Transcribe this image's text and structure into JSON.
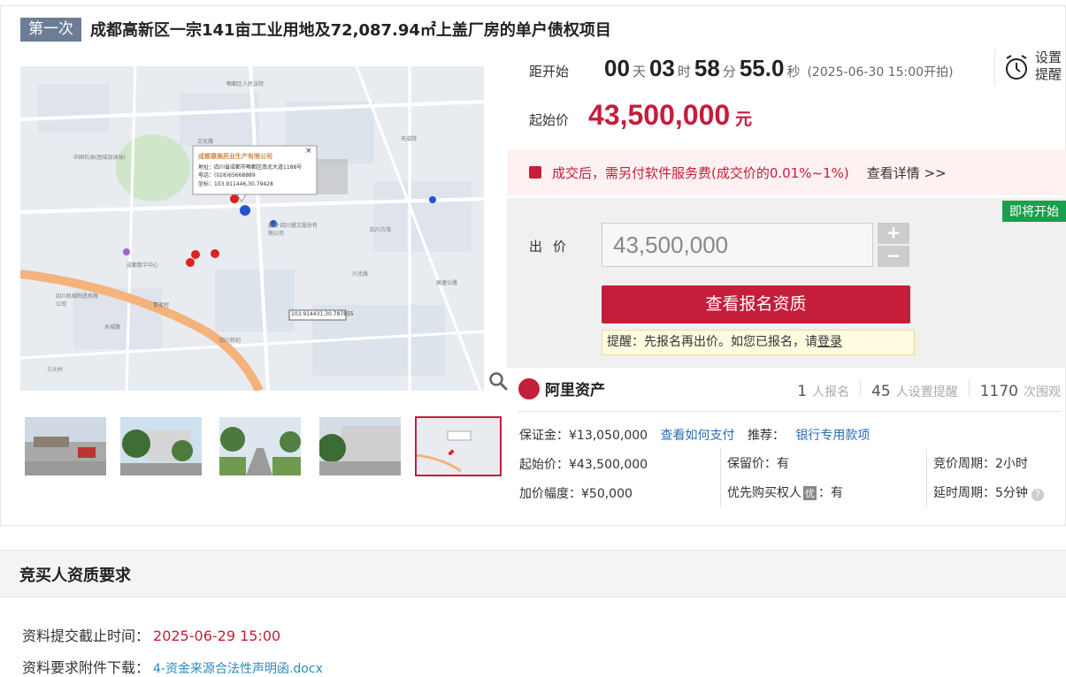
{
  "header": {
    "round_tag": "第一次",
    "title": "成都高新区一宗141亩工业用地及72,087.94㎡上盖厂房的单户债权项目"
  },
  "countdown": {
    "label": "距开始",
    "days": "00",
    "days_unit": "天",
    "hours": "03",
    "hours_unit": "时",
    "minutes": "58",
    "minutes_unit": "分",
    "seconds": "55.0",
    "seconds_unit": "秒",
    "start_text": "(2025-06-30 15:00开拍)"
  },
  "reminder": {
    "line1": "设置",
    "line2": "提醒",
    "icon": "alarm-clock-icon"
  },
  "start_price": {
    "label": "起始价",
    "value": "43,500,000",
    "unit": "元"
  },
  "fee_notice": {
    "text": "成交后，需另付软件服务费(成交价的0.01%~1%)",
    "link": "查看详情 >>"
  },
  "bid": {
    "badge": "即将开始",
    "label": "出价",
    "input_value": "43,500,000",
    "plus": "+",
    "minus": "−",
    "main_button": "查看报名资质",
    "notice_text": "提醒：先报名再出价。如您已报名，请",
    "notice_link": "登录"
  },
  "platform": {
    "name": "阿里资产"
  },
  "stats": [
    {
      "num": "1",
      "unit": "人报名"
    },
    {
      "num": "45",
      "unit": "人设置提醒"
    },
    {
      "num": "1170",
      "unit": "次围观"
    }
  ],
  "details": {
    "deposit": "保证金：¥13,050,000",
    "pay_link": "查看如何支付",
    "recommend_label": "推荐：",
    "recommend_link": "银行专用款项",
    "start_price": "起始价：¥43,500,000",
    "reserve": "保留价：有",
    "cycle": "竞价周期：2小时",
    "increment": "加价幅度：¥50,000",
    "priority_label": "优先购买权人",
    "priority_icon": "优",
    "priority_value": "：有",
    "delay": "延时周期：5分钟"
  },
  "map": {
    "company": "成都康美药业生产有限公司",
    "address": "地址：四川省成都市郫都区南北大道1188号",
    "phone": "电话：(028)65668889",
    "coord": "坐标：103.911446,30.79428",
    "coord_label": "103.914431,30.787855",
    "labels": [
      "郫都区人民法院",
      "天成院",
      "中国石油(团结加油站)",
      "文化路",
      "鑫豪·四川盛文股份有限公司",
      "四川方茂",
      "兴北路",
      "四川机械制造有限公司",
      "四川世纪",
      "成都数字中心",
      "曹家村",
      "水城路",
      "三元村",
      "高速公路"
    ]
  },
  "section": {
    "title": "竞买人资质要求",
    "deadline_label": "资料提交截止时间：",
    "deadline_value": "2025-06-29 15:00",
    "attach_label": "资料要求附件下载：",
    "attach_link": "4-资金来源合法性声明函.docx"
  }
}
